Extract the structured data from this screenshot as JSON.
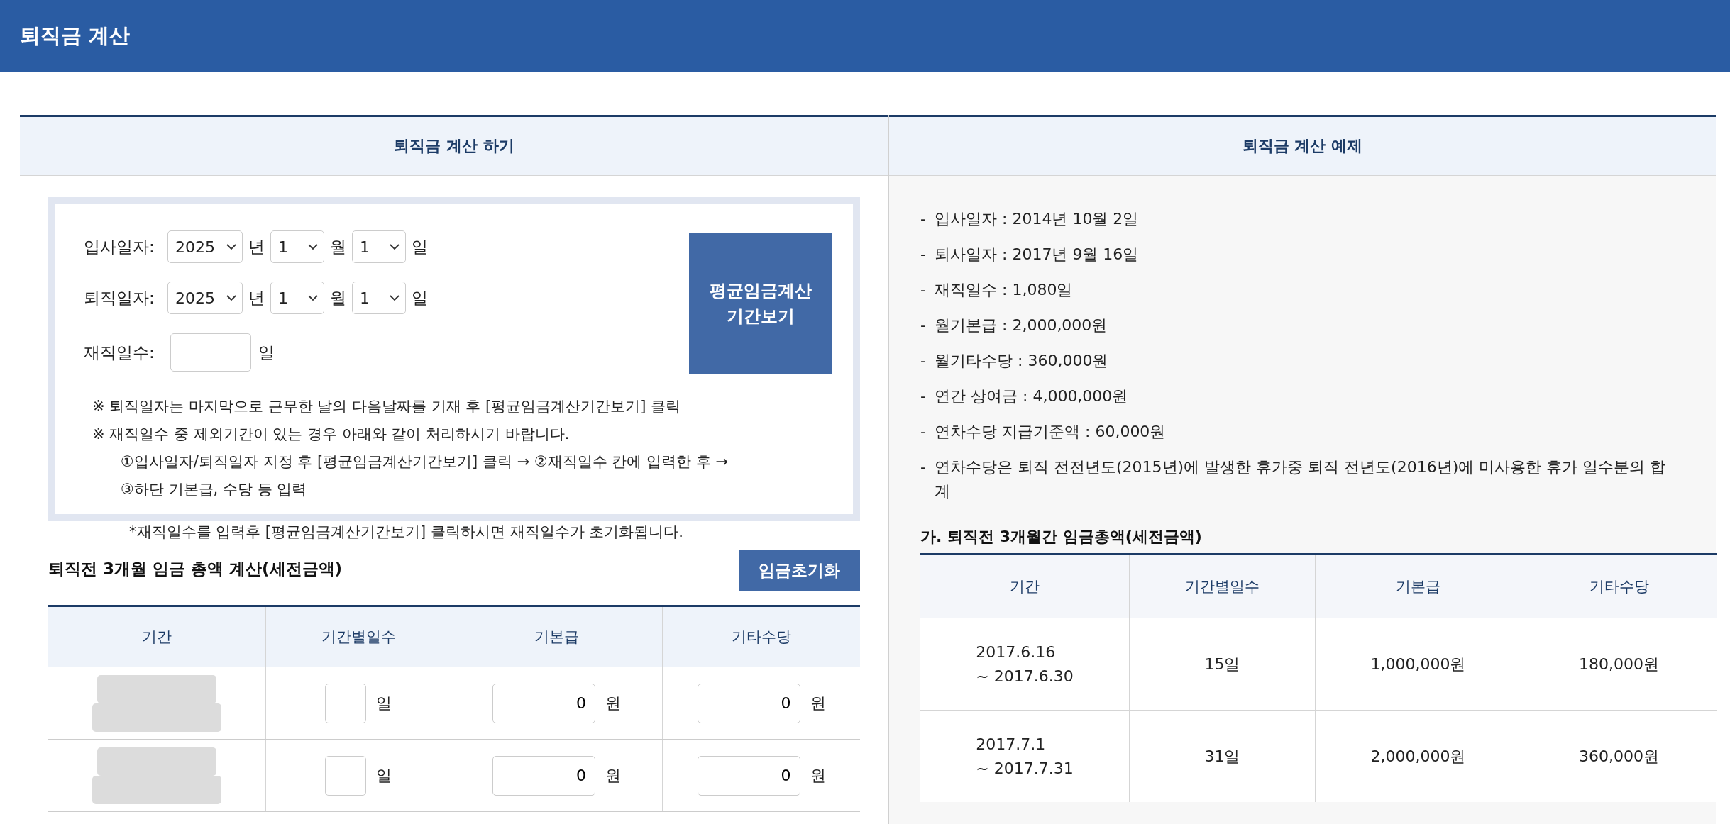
{
  "header": {
    "title": "퇴직금 계산"
  },
  "calculator": {
    "title": "퇴직금 계산 하기",
    "date_rows": [
      {
        "label": "입사일자:",
        "year": "2025",
        "year_unit": "년",
        "month": "1",
        "month_unit": "월",
        "day": "1",
        "day_unit": "일"
      },
      {
        "label": "퇴직일자:",
        "year": "2025",
        "year_unit": "년",
        "month": "1",
        "month_unit": "월",
        "day": "1",
        "day_unit": "일"
      }
    ],
    "days_worked": {
      "label": "재직일수:",
      "unit": "일"
    },
    "period_button": "평균임금계산 기간보기",
    "notes": [
      {
        "kind": "main",
        "text": "※ 퇴직일자는 마지막으로 근무한 날의 다음날짜를 기재 후 [평균임금계산기간보기] 클릭"
      },
      {
        "kind": "main",
        "text": "※ 재직일수 중 제외기간이 있는 경우 아래와 같이 처리하시기 바랍니다."
      },
      {
        "kind": "step",
        "text": "①입사일자/퇴직일자 지정 후 [평균임금계산기간보기] 클릭 → ②재직일수 칸에 입력한 후 →"
      },
      {
        "kind": "step",
        "text": "③하단 기본급, 수당 등 입력"
      }
    ],
    "footnote": "*재직일수를 입력후 [평균임금계산기간보기] 클릭하시면 재직일수가 초기화됩니다.",
    "wage_title": "퇴직전 3개월 임금 총액 계산(세전금액)",
    "reset_button": "임금초기화",
    "table": {
      "columns": [
        "기간",
        "기간별일수",
        "기본급",
        "기타수당"
      ],
      "rows": [
        {
          "days_unit": "일",
          "basic_pay": "0",
          "basic_unit": "원",
          "other_pay": "0",
          "other_unit": "원"
        },
        {
          "days_unit": "일",
          "basic_pay": "0",
          "basic_unit": "원",
          "other_pay": "0",
          "other_unit": "원"
        }
      ]
    }
  },
  "example": {
    "title": "퇴직금 계산 예제",
    "items": [
      {
        "bullet": "-",
        "text": "입사일자 : 2014년 10월 2일"
      },
      {
        "bullet": "-",
        "text": "퇴사일자 : 2017년 9월 16일"
      },
      {
        "bullet": "-",
        "text": "재직일수 : 1,080일"
      },
      {
        "bullet": "-",
        "text": "월기본급 : 2,000,000원"
      },
      {
        "bullet": "-",
        "text": "월기타수당 : 360,000원"
      },
      {
        "bullet": "-",
        "text": "연간 상여금 : 4,000,000원"
      },
      {
        "bullet": "-",
        "text": "연차수당 지급기준액 : 60,000원"
      },
      {
        "bullet": "-",
        "text": "연차수당은 퇴직 전전년도(2015년)에 발생한 휴가중 퇴직 전년도(2016년)에 미사용한 휴가 일수분의 합계"
      }
    ],
    "table_title": "가. 퇴직전 3개월간 임금총액(세전금액)",
    "table": {
      "columns": [
        "기간",
        "기간별일수",
        "기본급",
        "기타수당"
      ],
      "rows": [
        {
          "period_lines": [
            "2017.6.16",
            "~ 2017.6.30"
          ],
          "days": "15일",
          "basic_pay": "1,000,000원",
          "other_pay": "180,000원"
        },
        {
          "period_lines": [
            "2017.7.1",
            "~ 2017.7.31"
          ],
          "days": "31일",
          "basic_pay": "2,000,000원",
          "other_pay": "360,000원"
        }
      ]
    }
  }
}
